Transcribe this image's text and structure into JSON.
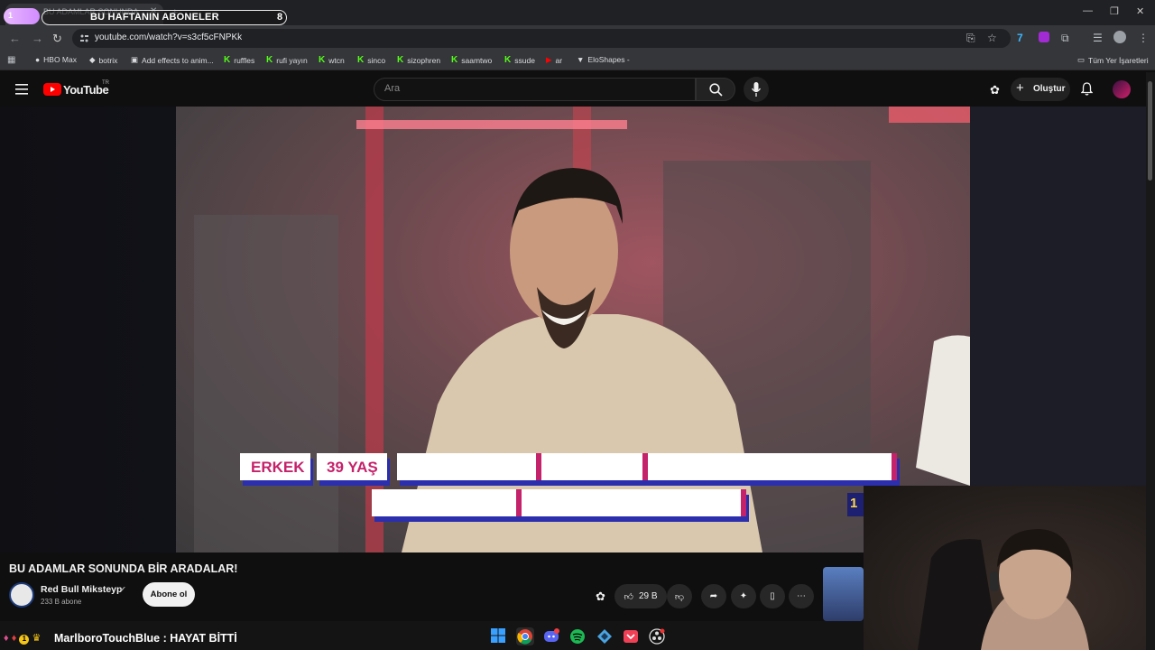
{
  "browser": {
    "tab_title": "BU ADAMLAR SONUNDA...",
    "overlay_title": "BU HAFTANIN ABONELER",
    "overlay_count": "8",
    "overlay_index": "1",
    "url": "youtube.com/watch?v=s3cf5cFNPKk",
    "all_bookmarks": "Tüm Yer İşaretleri",
    "bookmarks": [
      {
        "label": "HBO Max",
        "icon": "hbo-icon"
      },
      {
        "label": "botrix",
        "icon": "botrix-icon"
      },
      {
        "label": "Add effects to anim...",
        "icon": "effects-icon"
      },
      {
        "label": "ruffles",
        "icon": "kick-icon"
      },
      {
        "label": "rufi yayın",
        "icon": "kick-icon"
      },
      {
        "label": "wtcn",
        "icon": "kick-icon"
      },
      {
        "label": "sinco",
        "icon": "kick-icon"
      },
      {
        "label": "sizophren",
        "icon": "kick-icon"
      },
      {
        "label": "saamtwo",
        "icon": "kick-icon"
      },
      {
        "label": "ssude",
        "icon": "kick-icon"
      },
      {
        "label": "ar",
        "icon": "youtube-icon"
      },
      {
        "label": "EloShapes -",
        "icon": "eloshapes-icon"
      }
    ]
  },
  "youtube": {
    "logo_text": "YouTube",
    "logo_region": "TR",
    "search_placeholder": "Ara",
    "create_label": "Oluştur"
  },
  "video": {
    "overlay_labels": [
      "ERKEK",
      "39 YAŞ"
    ],
    "title": "BU ADAMLAR SONUNDA BİR ARADALAR!",
    "channel": "Red Bull Miksteyp",
    "subscribers": "233 B abone",
    "subscribe_label": "Abone ol",
    "likes": "29 B",
    "partial_number": "1"
  },
  "chat": {
    "line": "MarlboroTouchBlue : HAYAT BİTTİ",
    "badge_number": "1"
  },
  "colors": {
    "accent_pink": "#c4226a",
    "accent_blue": "#2b2fae",
    "youtube_red": "#ff0000"
  }
}
